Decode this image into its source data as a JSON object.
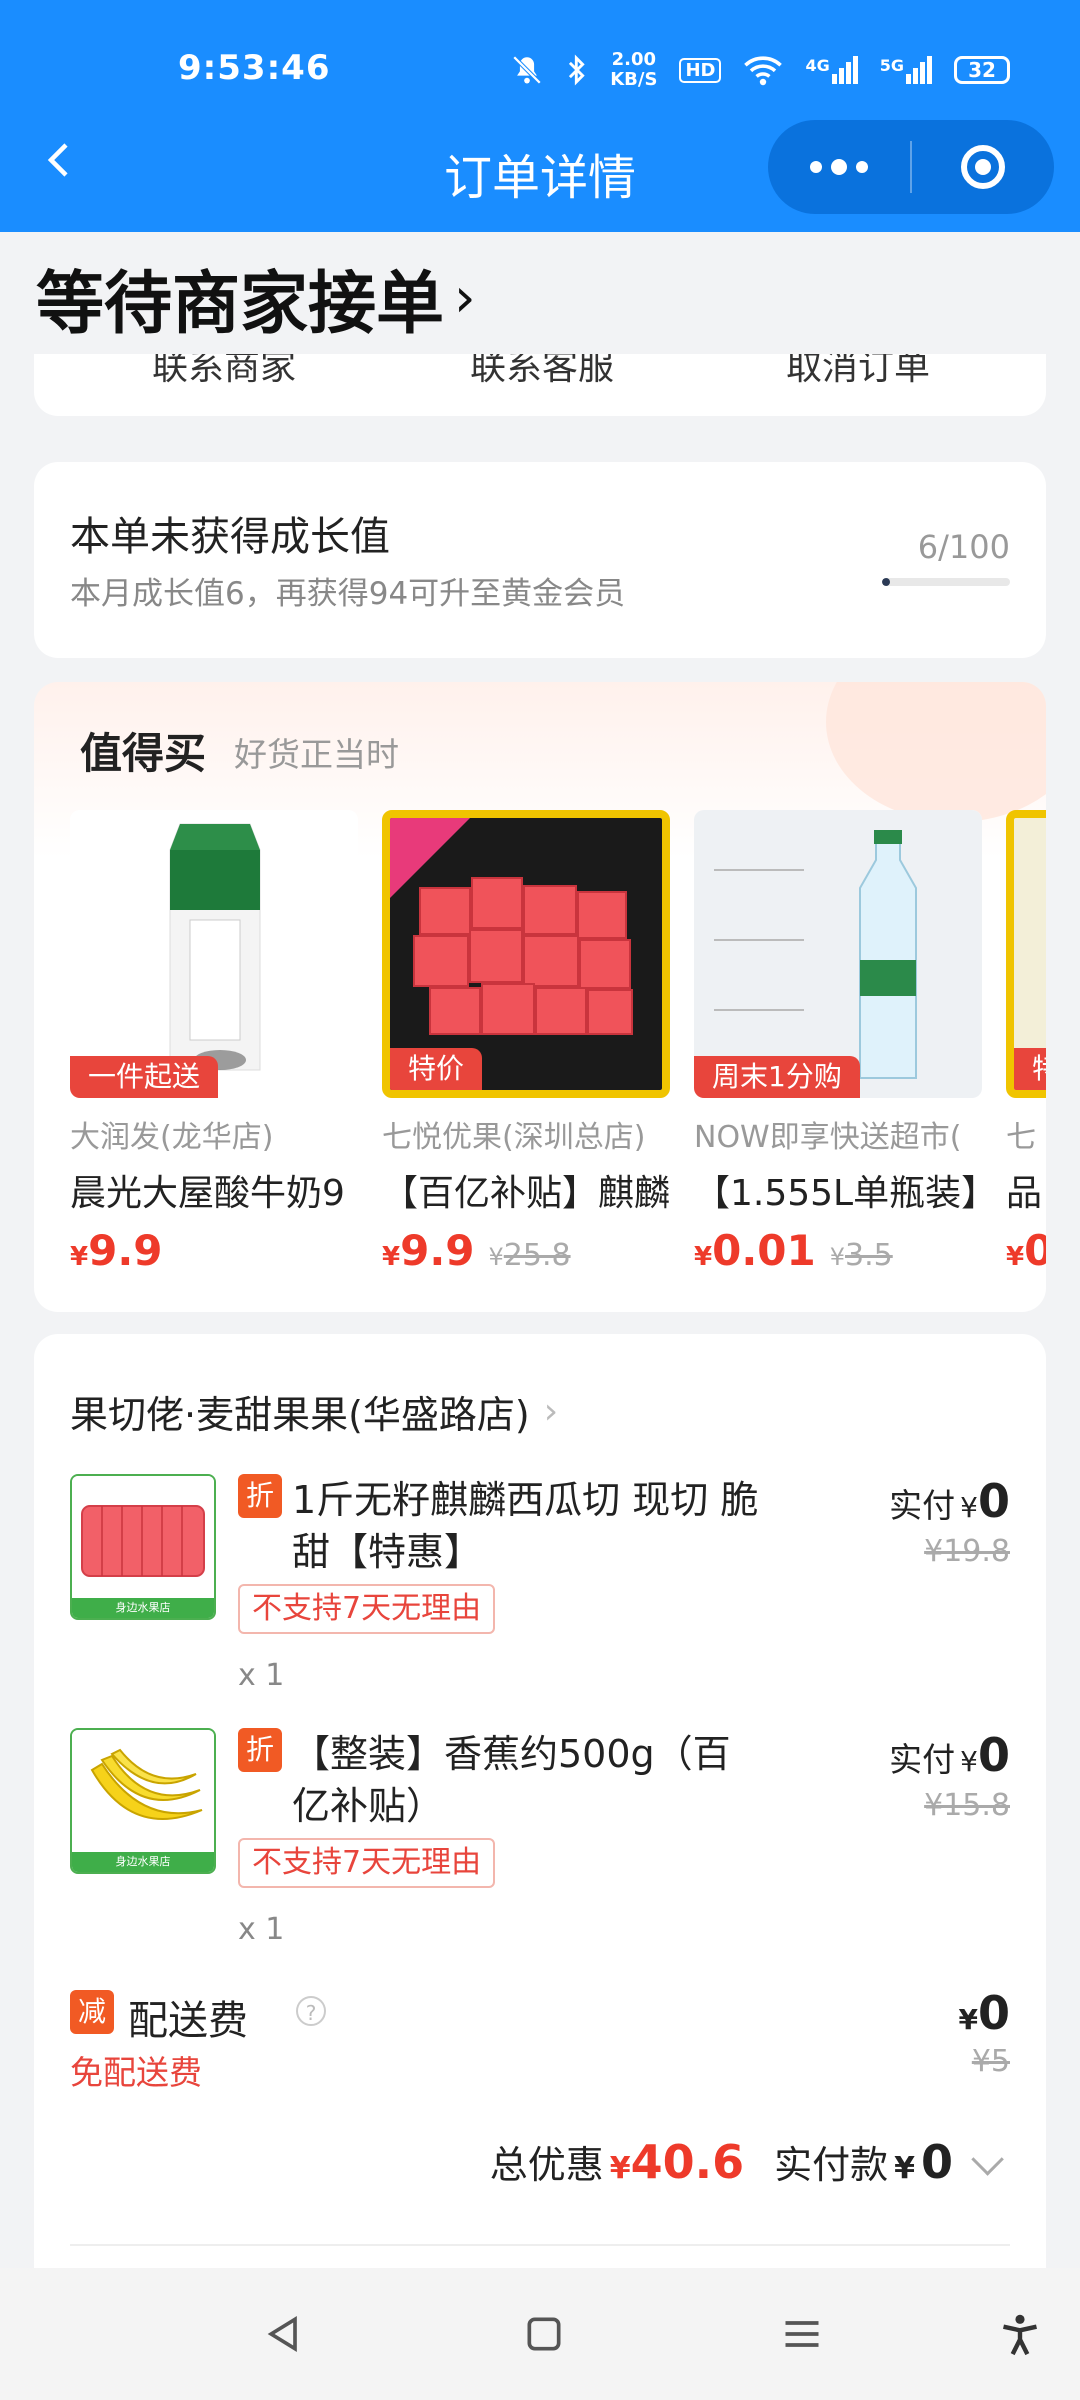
{
  "status_bar": {
    "time": "9:53:46",
    "net_speed": "2.00",
    "net_unit": "KB/S",
    "hd": "HD",
    "sig1": "4G",
    "sig2": "5G",
    "battery": "32"
  },
  "nav": {
    "title": "订单详情"
  },
  "order": {
    "status": "等待商家接单",
    "actions": [
      "联系商家",
      "联系客服",
      "取消订单"
    ]
  },
  "growth": {
    "title": "本单未获得成长值",
    "subtitle": "本月成长值6，再获得94可升至黄金会员",
    "progress_text": "6/100",
    "progress": 0.06
  },
  "worth": {
    "title": "值得买",
    "subtitle": "好货正当时",
    "products": [
      {
        "tag": "一件起送",
        "shop": "大润发(龙华店)",
        "name": "晨光大屋酸牛奶9",
        "currency": "¥",
        "price": "9.9",
        "old_price": ""
      },
      {
        "tag": "特价",
        "shop": "七悦优果(深圳总店)",
        "name": "【百亿补贴】麒麟",
        "currency": "¥",
        "price": "9.9",
        "old_price": "25.8"
      },
      {
        "tag": "周末1分购",
        "shop": "NOW即享快送超市(",
        "name": "【1.555L单瓶装】",
        "currency": "¥",
        "price": "0.01",
        "old_price": "3.5"
      },
      {
        "tag": "特",
        "shop": "七",
        "name": "品",
        "currency": "¥",
        "price": "0",
        "old_price": ""
      }
    ]
  },
  "store": {
    "name": "果切佬·麦甜果果(华盛路店)",
    "items": [
      {
        "badge": "折",
        "title": "1斤无籽麒麟西瓜切 现切 脆甜【特惠】",
        "policy": "不支持7天无理由",
        "qty": "x 1",
        "paid_label": "实付",
        "currency": "¥",
        "paid": "0",
        "original": "¥19.8"
      },
      {
        "badge": "折",
        "title": "【整装】香蕉约500g（百亿补贴）",
        "policy": "不支持7天无理由",
        "qty": "x 1",
        "paid_label": "实付",
        "currency": "¥",
        "paid": "0",
        "original": "¥15.8"
      }
    ],
    "fee": {
      "badge": "减",
      "label": "配送费",
      "note": "免配送费",
      "currency": "¥",
      "value": "0",
      "original": "¥5"
    },
    "summary": {
      "discount_label": "总优惠",
      "currency": "¥",
      "discount": "40.6",
      "pay_label": "实付款",
      "pay": "0"
    }
  },
  "colors": {
    "primary": "#1a8dff",
    "price_red": "#ee3a2a",
    "tag_red": "#e8453c",
    "badge_orange": "#f15a24"
  }
}
